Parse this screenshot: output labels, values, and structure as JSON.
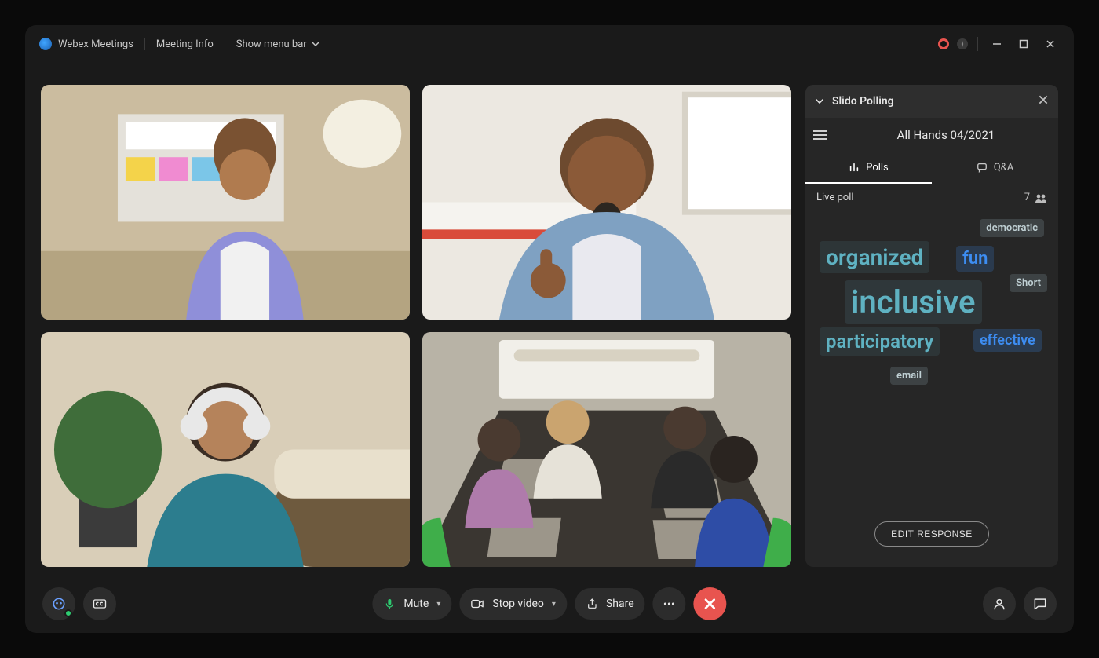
{
  "titlebar": {
    "app_name": "Webex Meetings",
    "meeting_info": "Meeting Info",
    "show_menu": "Show menu bar"
  },
  "panel": {
    "title": "Slido Polling",
    "session": "All Hands 04/2021",
    "tabs": {
      "polls": "Polls",
      "qa": "Q&A"
    },
    "poll_label": "Live poll",
    "participants": "7",
    "words": {
      "inclusive": "inclusive",
      "organized": "organized",
      "participatory": "participatory",
      "fun": "fun",
      "effective": "effective",
      "democratic": "democratic",
      "short": "Short",
      "email": "email"
    },
    "edit": "EDIT RESPONSE"
  },
  "toolbar": {
    "mute": "Mute",
    "stop_video": "Stop video",
    "share": "Share"
  }
}
